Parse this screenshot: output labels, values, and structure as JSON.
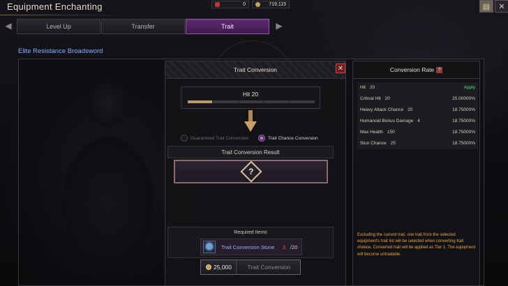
{
  "window": {
    "title": "Equipment Enchanting",
    "close_icon": "close-icon",
    "book_icon": "book-icon"
  },
  "currencies": [
    {
      "icon": "red-gem-icon",
      "value": "0"
    },
    {
      "icon": "gold-coin-icon",
      "value": "719,115"
    }
  ],
  "tabs": [
    {
      "label": "Level Up",
      "active": false
    },
    {
      "label": "Transfer",
      "active": false
    },
    {
      "label": "Trait",
      "active": true
    }
  ],
  "item": {
    "name": "Elite Resistance Broadsword"
  },
  "conversion": {
    "title": "Trait Conversion",
    "current_trait": "Hit 20",
    "trait_bar_progress": 0.2,
    "options": [
      {
        "label": "Guaranteed Trait Conversion",
        "selected": false
      },
      {
        "label": "Trait Chance Conversion",
        "selected": true
      }
    ],
    "result_title": "Trait Conversion Result",
    "result_placeholder": "?",
    "required_title": "Required Items",
    "required_item": {
      "name": "Trait Conversion Stone",
      "have": "3",
      "need": "/20"
    },
    "cost": "25,000",
    "action_label": "Trait Conversion"
  },
  "rates": {
    "title": "Conversion Rate",
    "help_icon": "?",
    "rows": [
      {
        "name": "Hit",
        "level": "20",
        "value": "Apply",
        "apply": true
      },
      {
        "name": "Critical Hit",
        "level": "20",
        "value": "25.00000%"
      },
      {
        "name": "Heavy Attack Chance",
        "level": "20",
        "value": "18.75000%"
      },
      {
        "name": "Humanoid Bonus Damage",
        "level": "4",
        "value": "18.75000%"
      },
      {
        "name": "Max Health",
        "level": "150",
        "value": "18.75000%"
      },
      {
        "name": "Stun Chance",
        "level": "25",
        "value": "18.75000%"
      }
    ],
    "note": "Excluding the current trait, one trait from the selected equipment's trait list will be selected when converting trait chance. Converted trait will be applied as Tier 1. The equipment will become untradable."
  },
  "colors": {
    "active_tab": "#5e2a70",
    "item_name": "#7fb2ff",
    "apply": "#5fe37a",
    "warning_note": "#e8a44a",
    "insufficient": "#ff5a4e"
  }
}
